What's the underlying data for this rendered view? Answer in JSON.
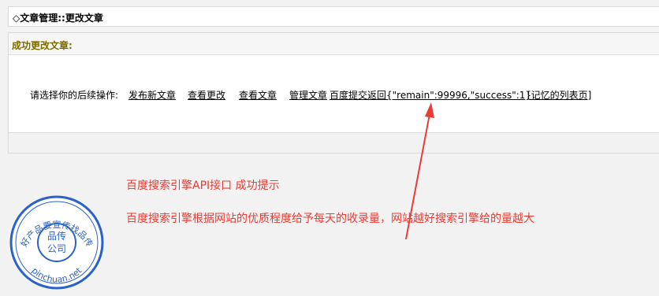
{
  "header": {
    "title": "◇文章管理::更改文章"
  },
  "result": {
    "heading": "成功更改文章:",
    "prompt_label": "请选择你的后续操作:",
    "links": [
      "发布新文章",
      "查看更改",
      "查看文章",
      "管理文章",
      "百度提交返回{\"remain\":99996,\"success\":1}",
      "[记忆的列表页]"
    ]
  },
  "annotation": {
    "line1": "百度搜索引擎API接口   成功提示",
    "line2": "百度搜索引擎根据网站的优质程度给予每天的收录量，网站越好搜索引擎给的量越大",
    "color": "#e83c34"
  },
  "stamp": {
    "arc_text": "好产品要宣传找品传",
    "center_top": "品传",
    "center_bottom": "公司",
    "url": "pinchuan.net",
    "color": "#2a62c9"
  }
}
